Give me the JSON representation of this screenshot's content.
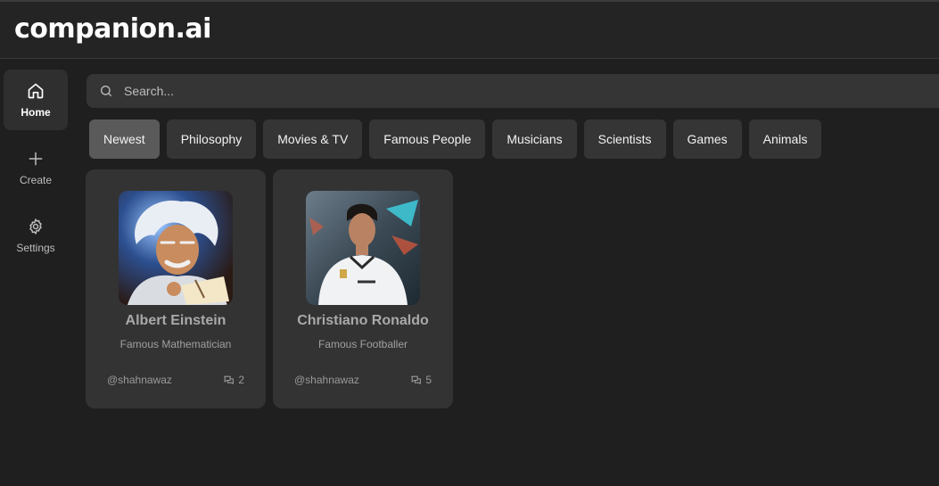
{
  "app": {
    "title": "companion.ai"
  },
  "sidebar": {
    "items": [
      {
        "label": "Home",
        "icon": "home-icon",
        "active": true
      },
      {
        "label": "Create",
        "icon": "plus-icon",
        "active": false
      },
      {
        "label": "Settings",
        "icon": "gear-icon",
        "active": false
      }
    ]
  },
  "search": {
    "placeholder": "Search...",
    "value": "",
    "icon": "search-icon"
  },
  "categories": [
    {
      "label": "Newest",
      "active": true
    },
    {
      "label": "Philosophy"
    },
    {
      "label": "Movies & TV"
    },
    {
      "label": "Famous People"
    },
    {
      "label": "Musicians"
    },
    {
      "label": "Scientists"
    },
    {
      "label": "Games"
    },
    {
      "label": "Animals"
    }
  ],
  "companions": [
    {
      "name": "Albert Einstein",
      "description": "Famous Mathematician",
      "author": "@shahnawaz",
      "messages": "2",
      "icon": "messages-icon"
    },
    {
      "name": "Christiano Ronaldo",
      "description": "Famous Footballer",
      "author": "@shahnawaz",
      "messages": "5",
      "icon": "messages-icon"
    }
  ],
  "colors": {
    "background": "#1f1f1f",
    "panel": "#353535",
    "card": "#333333",
    "active_chip": "#5a5a5a"
  }
}
